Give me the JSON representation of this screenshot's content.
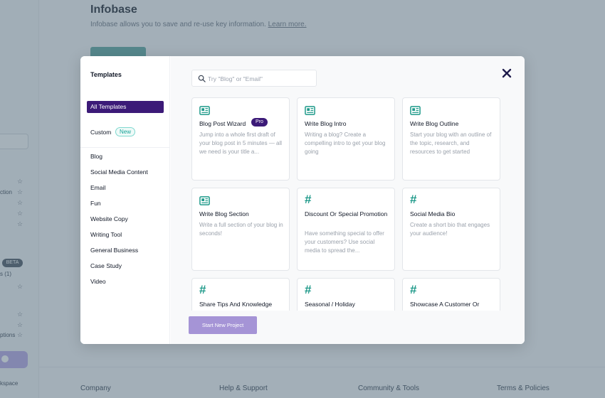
{
  "background": {
    "title": "Infobase",
    "subtitle": "Infobase allows you to save and re-use key information.",
    "learn_more": "Learn more.",
    "side_fragments": [
      "ction",
      "BETA",
      "s (1)",
      "ptions",
      "kspace"
    ],
    "footer": [
      "Company",
      "Help & Support",
      "Community & Tools",
      "Terms & Policies"
    ]
  },
  "modal": {
    "sidebar": {
      "title": "Templates",
      "all_templates": "All Templates",
      "custom": "Custom",
      "new_badge": "New",
      "categories": [
        "Blog",
        "Social Media Content",
        "Email",
        "Fun",
        "Website Copy",
        "Writing Tool",
        "General Business",
        "Case Study",
        "Video"
      ]
    },
    "search": {
      "placeholder": "Try \"Blog\" or \"Email\""
    },
    "cards": [
      {
        "title": "Blog Post Wizard",
        "badge": "Pro",
        "icon": "newspaper-icon",
        "desc": "Jump into a whole first draft of your blog post in 5 minutes — all we need is your title a..."
      },
      {
        "title": "Write Blog Intro",
        "icon": "newspaper-icon",
        "desc": "Writing a blog? Create a compelling intro to get your blog going"
      },
      {
        "title": "Write Blog Outline",
        "icon": "newspaper-icon",
        "desc": "Start your blog with an outline of the topic, research, and resources to get started"
      },
      {
        "title": "Write Blog Section",
        "icon": "newspaper-icon",
        "desc": "Write a full section of your blog in seconds!"
      },
      {
        "title": "Discount Or Special Promotion",
        "icon": "hash-icon",
        "desc": "Have something special to offer your customers? Use social media to spread the..."
      },
      {
        "title": "Social Media Bio",
        "icon": "hash-icon",
        "desc": "Create a short bio that engages your audience!"
      },
      {
        "title": "Share Tips And Knowledge",
        "icon": "hash-icon",
        "desc": ""
      },
      {
        "title": "Seasonal / Holiday",
        "icon": "hash-icon",
        "desc": ""
      },
      {
        "title": "Showcase A Customer Or Testimonial",
        "icon": "hash-icon",
        "desc": ""
      }
    ],
    "start_button": "Start New Project"
  },
  "colors": {
    "accent": "#3c1a78",
    "teal": "#1f9a8a",
    "button": "#a594d6"
  }
}
